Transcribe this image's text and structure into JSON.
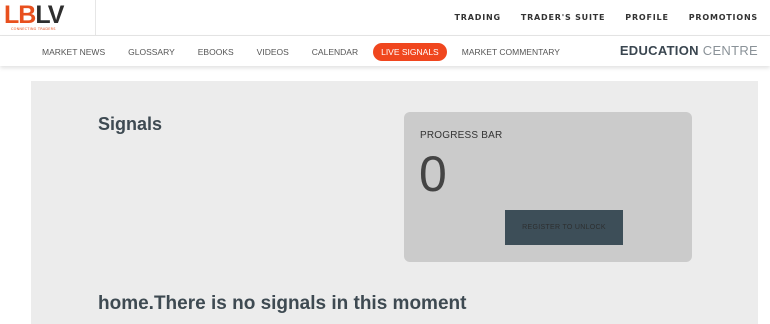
{
  "brand": {
    "logo_a": "LB",
    "logo_b": "LV",
    "tagline": "CONNECTING TRADERS"
  },
  "top_nav": [
    "TRADING",
    "TRADER'S SUITE",
    "PROFILE",
    "PROMOTIONS"
  ],
  "sub_nav": [
    "MARKET NEWS",
    "GLOSSARY",
    "EBOOKS",
    "VIDEOS",
    "CALENDAR",
    "LIVE SIGNALS",
    "MARKET COMMENTARY"
  ],
  "sub_nav_active": "LIVE SIGNALS",
  "section": {
    "bold": "EDUCATION",
    "light": "CENTRE"
  },
  "main": {
    "title": "Signals",
    "progress": {
      "label": "PROGRESS BAR",
      "value": "0",
      "button": "REGISTER TO UNLOCK"
    },
    "empty_message": "home.There is no signals in this moment"
  },
  "colors": {
    "accent": "#f0461e",
    "dark": "#3d4e58",
    "panel": "#ececec",
    "card": "#cbcbcb"
  }
}
